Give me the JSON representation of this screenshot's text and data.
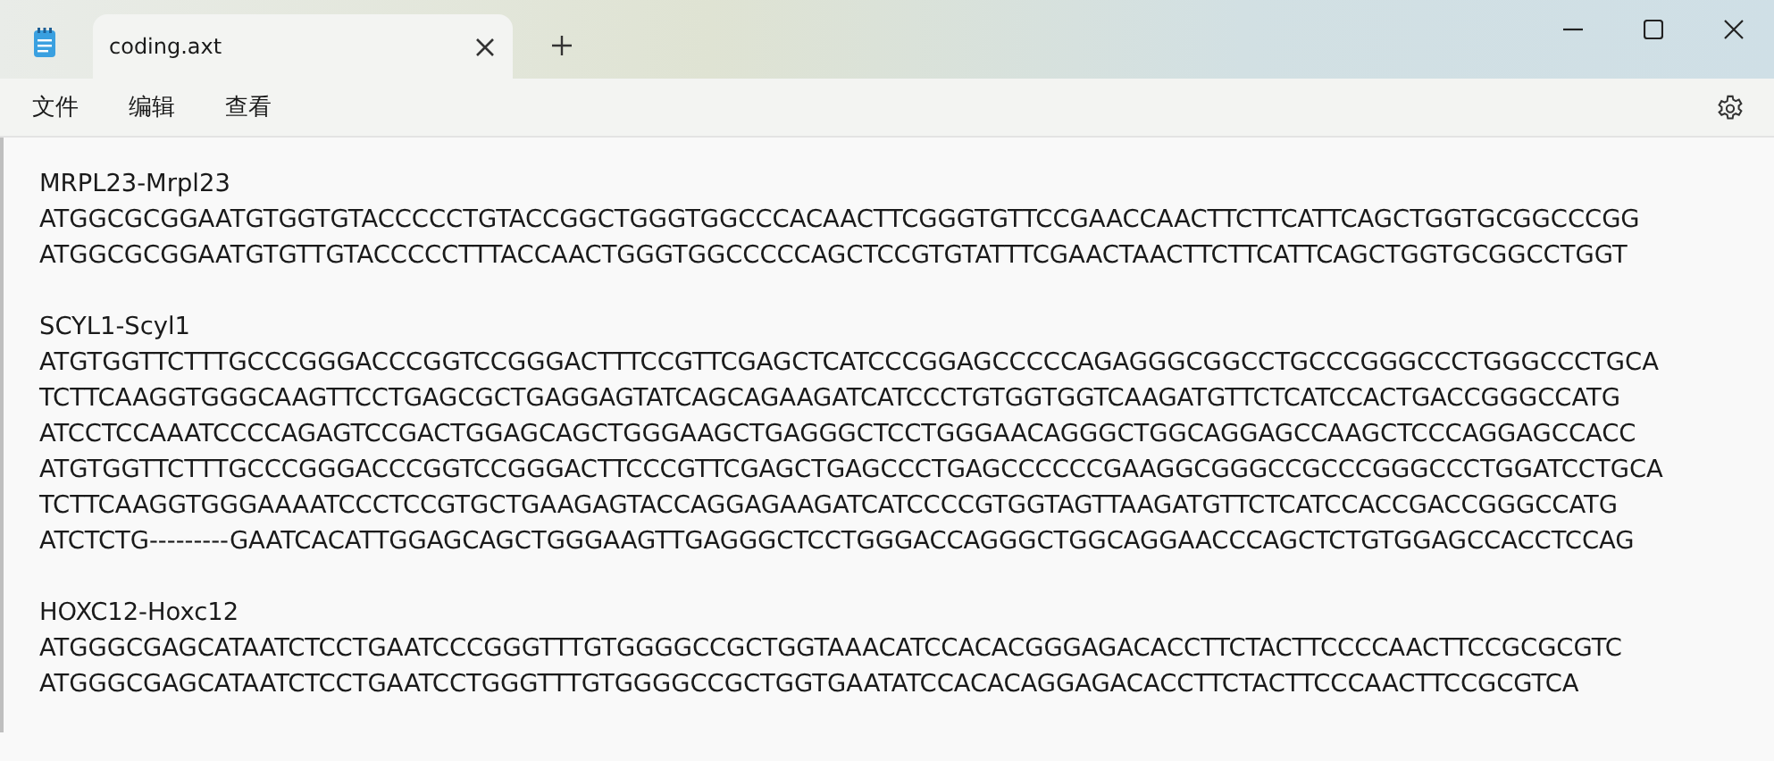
{
  "window": {
    "tabs": [
      {
        "title": "coding.axt",
        "selected": true
      }
    ]
  },
  "menu": [
    "文件",
    "编辑",
    "查看"
  ],
  "document": {
    "sections": [
      {
        "heading": "MRPL23-Mrpl23",
        "sequences": [
          "ATGGCGCGGAATGTGGTGTACCCCCTGTACCGGCTGGGTGGCCCACAACTTCGGGTGTTCCGAACCAACTTCTTCATTCAGCTGGTGCGGCCCGG",
          "ATGGCGCGGAATGTGTTGTACCCCCTTTACCAACTGGGTGGCCCCCAGCTCCGTGTATTTCGAACTAACTTCTTCATTCAGCTGGTGCGGCCTGGT"
        ]
      },
      {
        "heading": "SCYL1-Scyl1",
        "sequences": [
          "ATGTGGTTCTTTGCCCGGGACCCGGTCCGGGACTTTCCGTTCGAGCTCATCCCGGAGCCCCCAGAGGGCGGCCTGCCCGGGCCCTGGGCCCTGCA",
          "TCTTCAAGGTGGGCAAGTTCCTGAGCGCTGAGGAGTATCAGCAGAAGATCATCCCTGTGGTGGTCAAGATGTTCTCATCCACTGACCGGGCCATG",
          "ATCCTCCAAATCCCCAGAGTCCGACTGGAGCAGCTGGGAAGCTGAGGGCTCCTGGGAACAGGGCTGGCAGGAGCCAAGCTCCCAGGAGCCACC",
          "ATGTGGTTCTTTGCCCGGGACCCGGTCCGGGACTTCCCGTTCGAGCTGAGCCCTGAGCCCCCCGAAGGCGGGCCGCCCGGGCCCTGGATCCTGCA",
          "TCTTCAAGGTGGGAAAATCCCTCCGTGCTGAAGAGTACCAGGAGAAGATCATCCCCGTGGTAGTTAAGATGTTCTCATCCACCGACCGGGCCATG",
          "ATCTCTG---------GAATCACATTGGAGCAGCTGGGAAGTTGAGGGCTCCTGGGACCAGGGCTGGCAGGAACCCAGCTCTGTGGAGCCACCTCCAG"
        ]
      },
      {
        "heading": "HOXC12-Hoxc12",
        "sequences": [
          "ATGGGCGAGCATAATCTCCTGAATCCCGGGTTTGTGGGGCCGCTGGTAAACATCCACACGGGAGACACCTTCTACTTCCCCAACTTCCGCGCGTC",
          "ATGGGCGAGCATAATCTCCTGAATCCTGGGTTTGTGGGGCCGCTGGTGAATATCCACACAGGAGACACCTTCTACTTCCCAACTTCCGCGTCA"
        ]
      }
    ]
  }
}
